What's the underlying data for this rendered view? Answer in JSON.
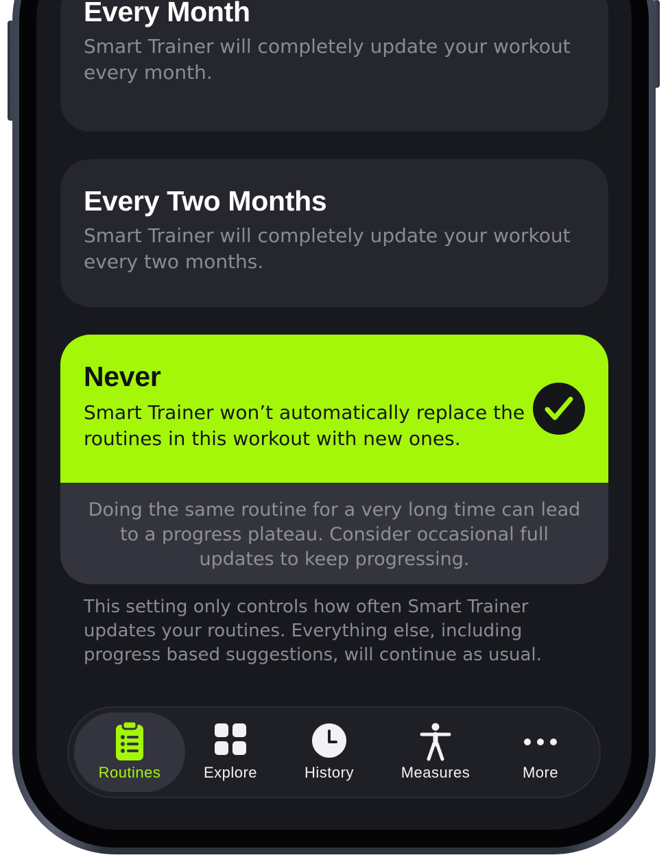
{
  "options": [
    {
      "title": "Every Month",
      "description": "Smart Trainer will completely update your workout every month.",
      "selected": false
    },
    {
      "title": "Every Two Months",
      "description": "Smart Trainer will completely update your workout every two months.",
      "selected": false
    },
    {
      "title": "Never",
      "description": "Smart Trainer won’t automatically replace the routines in this workout with new ones.",
      "selected": true,
      "warning": "Doing the same routine for a very long time can lead to a progress plateau. Consider occasional full updates to keep progressing."
    }
  ],
  "footnote": "This setting only controls how often Smart Trainer updates your routines. Everything else, including progress based suggestions, will continue as usual.",
  "tabbar": {
    "active": "Routines",
    "items": [
      {
        "label": "Routines",
        "icon": "clipboard-list-icon"
      },
      {
        "label": "Explore",
        "icon": "grid-icon"
      },
      {
        "label": "History",
        "icon": "clock-icon"
      },
      {
        "label": "Measures",
        "icon": "person-figure-icon"
      },
      {
        "label": "More",
        "icon": "ellipsis-icon"
      }
    ]
  },
  "colors": {
    "accent": "#a5f70a",
    "background": "#18191e",
    "card": "#26272e"
  }
}
